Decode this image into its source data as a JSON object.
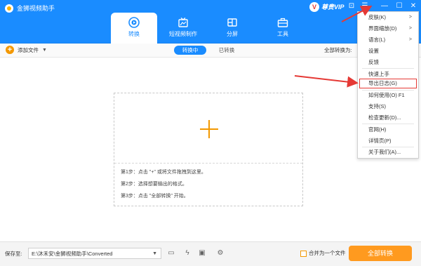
{
  "app": {
    "title": "金狮视频助手"
  },
  "tabs": [
    {
      "label": "转换",
      "icon": "play-circle-icon",
      "active": true
    },
    {
      "label": "短视频制作",
      "icon": "short-video-icon",
      "active": false
    },
    {
      "label": "分屏",
      "icon": "split-screen-icon",
      "active": false
    },
    {
      "label": "工具",
      "icon": "toolbox-icon",
      "active": false
    }
  ],
  "vip": {
    "label": "尊贵VIP",
    "badge": "V"
  },
  "window_controls": [
    {
      "icon": "feedback-icon",
      "glyph": "⊡"
    },
    {
      "icon": "menu-icon",
      "glyph": "☰"
    },
    {
      "icon": "minimize-icon",
      "glyph": "—"
    },
    {
      "icon": "maximize-icon",
      "glyph": "☐"
    },
    {
      "icon": "close-icon",
      "glyph": "✕"
    }
  ],
  "menu": {
    "items": [
      {
        "label": "皮肤(K)",
        "submenu": true
      },
      {
        "label": "界面缩放(D)",
        "submenu": true
      },
      {
        "label": "语言(L)",
        "submenu": true
      },
      {
        "label": "设置",
        "submenu": false
      },
      {
        "label": "反馈",
        "submenu": false
      },
      {
        "label": "快速上手",
        "submenu": false
      },
      {
        "label": "导出日志(G)",
        "submenu": false,
        "highlighted": true
      },
      {
        "label": "如何使用(O)   F1",
        "submenu": false
      },
      {
        "label": "支持(S)",
        "submenu": false
      },
      {
        "label": "检查更新(D)...",
        "submenu": false
      },
      {
        "label": "官网(H)",
        "submenu": false
      },
      {
        "label": "详情页(P)",
        "submenu": false
      },
      {
        "label": "关于我们(A)...",
        "submenu": false
      }
    ],
    "submenu_arrow": ">"
  },
  "toolbar": {
    "add_icon": "+",
    "add_label": "添加文件",
    "add_caret": "▼",
    "tab_converting": "转换中",
    "tab_converted": "已转换",
    "convert_all_to": "全部转换为:"
  },
  "dropzone": {
    "steps": [
      "第1步：点击 \"+\" 或将文件拖拽到这里。",
      "第2步：选择想要输出的格式。",
      "第3步：点击 \"全部转换\" 开始。"
    ]
  },
  "footer": {
    "save_label": "保存至:",
    "path": "E:\\沐禾安\\金狮视频助手\\Converted",
    "path_caret": "▼",
    "icons": [
      {
        "name": "open-folder-icon",
        "glyph": "▭"
      },
      {
        "name": "hardware-accel-off-icon",
        "glyph": "ϟ"
      },
      {
        "name": "gpu-off-icon",
        "glyph": "▣"
      },
      {
        "name": "settings-icon",
        "glyph": "⚙"
      }
    ],
    "merge_label": "合并为一个文件",
    "convert_all_button": "全部转换"
  },
  "colors": {
    "header": "#1a8cff",
    "accent_orange": "#ff9a1f",
    "annotation_red": "#e53935"
  }
}
